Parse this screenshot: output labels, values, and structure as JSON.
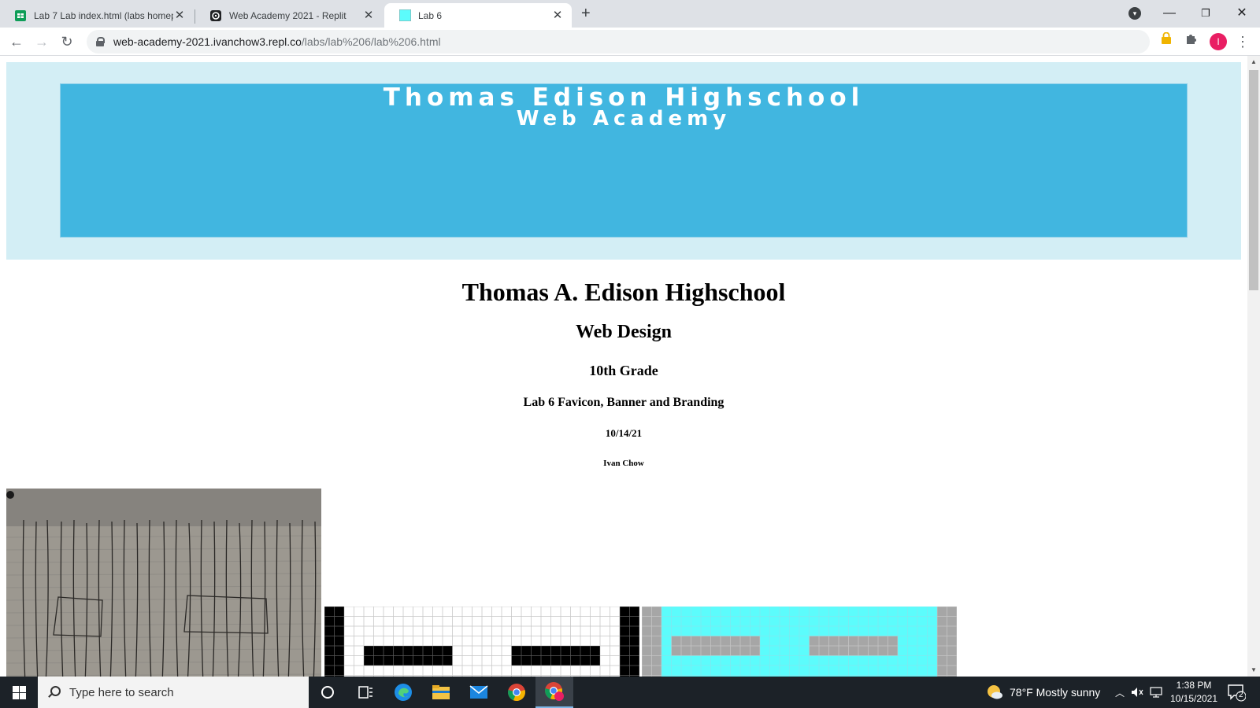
{
  "browser": {
    "tabs": [
      {
        "title": "Lab 7 Lab index.html (labs homep",
        "icon": "google-sheets-icon"
      },
      {
        "title": "Web Academy 2021 - Replit",
        "icon": "replit-icon"
      },
      {
        "title": "Lab 6",
        "icon": "cyan-favicon-icon"
      }
    ],
    "url_host": "web-academy-2021.ivanchow3.repl.co",
    "url_path": "/labs/lab%206/lab%206.html",
    "profile_initial": "I"
  },
  "page": {
    "banner": {
      "line1": "Thomas Edison Highschool",
      "line2": "Web Academy"
    },
    "h1": "Thomas A. Edison Highschool",
    "h2": "Web Design",
    "h3": "10th Grade",
    "h4": "Lab 6 Favicon, Banner and Branding",
    "h5": "10/14/21",
    "h6": "Ivan Chow"
  },
  "taskbar": {
    "search_placeholder": "Type here to search",
    "weather": "78°F  Mostly sunny",
    "time": "1:38 PM",
    "date": "10/15/2021",
    "notification_count": "2"
  },
  "colors": {
    "banner_bg": "#41b6e0",
    "banner_wrap_bg": "#d3eef5",
    "favicon_cyan": "#5cfcfc"
  }
}
